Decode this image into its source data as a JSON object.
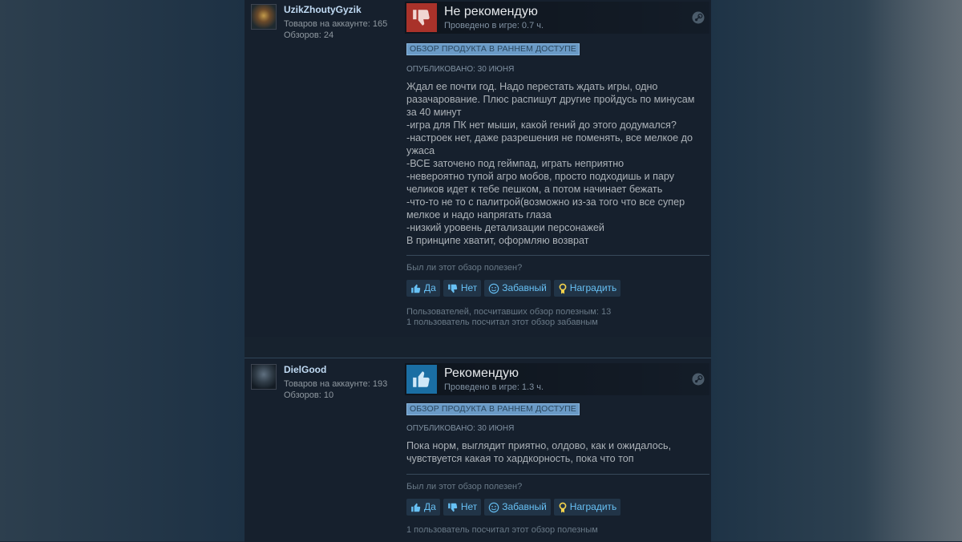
{
  "reviews": [
    {
      "username": "UzikZhoutyGyzik",
      "products_text": "Товаров на аккаунте: 165",
      "reviews_text": "Обзоров: 24",
      "verdict": "Не рекомендую",
      "verdict_type": "negative",
      "playtime": "Проведено в игре: 0.7 ч.",
      "badge": "ОБЗОР ПРОДУКТА В РАННЕМ ДОСТУПЕ",
      "posted": "ОПУБЛИКОВАНО: 30 ИЮНЯ",
      "body": "Ждал ее почти год. Надо перестать ждать игры, одно разачарование. Плюс распишут другие пройдусь по минусам за 40 минут\n-игра для ПК нет мыши, какой гений до этого додумался?\n-настроек нет, даже разрешения не поменять, все мелкое до ужаса\n-ВСЕ заточено под геймпад, играть неприятно\n-невероятно тупой агро мобов, просто подходишь и пару челиков идет к тебе пешком, а потом начинает бежать\n-что-то не то с палитрой(возможно из-за того что все супер мелкое и надо напрягать глаза\n-низкий уровень детализации персонажей\nВ принципе хватит, оформляю возврат",
      "helpful_question": "Был ли этот обзор полезен?",
      "buttons": {
        "yes": "Да",
        "no": "Нет",
        "funny": "Забавный",
        "award": "Наградить"
      },
      "stats_1": "Пользователей, посчитавших обзор полезным: 13",
      "stats_2": "1 пользователь посчитал этот обзор забавным"
    },
    {
      "username": "DielGood",
      "products_text": "Товаров на аккаунте: 193",
      "reviews_text": "Обзоров: 10",
      "verdict": "Рекомендую",
      "verdict_type": "positive",
      "playtime": "Проведено в игре: 1.3 ч.",
      "badge": "ОБЗОР ПРОДУКТА В РАННЕМ ДОСТУПЕ",
      "posted": "ОПУБЛИКОВАНО: 30 ИЮНЯ",
      "body": "Пока норм, выглядит приятно, олдово, как и ожидалось, чувствуется какая то хардкорность, пока что топ",
      "helpful_question": "Был ли этот обзор полезен?",
      "buttons": {
        "yes": "Да",
        "no": "Нет",
        "funny": "Забавный",
        "award": "Наградить"
      },
      "stats_1": "1 пользователь посчитал этот обзор полезным"
    }
  ],
  "colors": {
    "negative": "#a9322a",
    "positive": "#1a6ea3",
    "link": "#67c1f5",
    "badge": "#6a9ac6"
  },
  "icons": [
    "thumbs-down-icon",
    "thumbs-up-icon",
    "steam-icon",
    "smiley-icon",
    "award-icon"
  ]
}
